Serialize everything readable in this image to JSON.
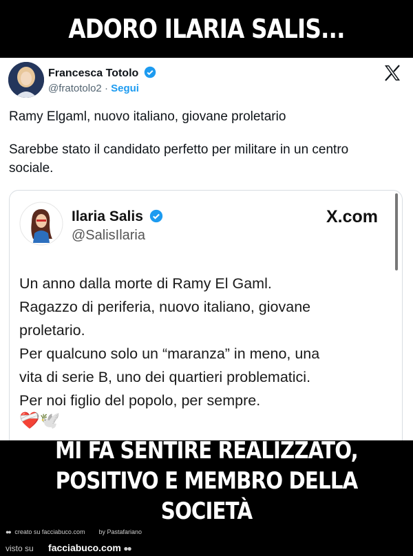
{
  "meme": {
    "top_caption": "ADORO ILARIA SALIS...",
    "bottom_caption_line1": "MI FA SENTIRE REALIZZATO,",
    "bottom_caption_line2": "POSITIVO E MEMBRO DELLA SOCIETÀ"
  },
  "tweet": {
    "author_name": "Francesca Totolo",
    "author_handle": "@fratotolo2",
    "separator": "·",
    "follow_label": "Segui",
    "text_line1": "Ramy Elgaml, nuovo italiano, giovane proletario",
    "text_line2": "Sarebbe stato il candidato perfetto per militare in un centro sociale.",
    "icons": {
      "verified": "verified-badge-icon",
      "platform": "x-logo-icon"
    }
  },
  "quoted": {
    "author_name": "Ilaria Salis",
    "author_handle": "@SalisIlaria",
    "site": "X.com",
    "lines": [
      "Un anno dalla morte di Ramy El Gaml.",
      "Ragazzo di periferia, nuovo italiano, giovane",
      "proletario.",
      "Per qualcuno solo un “maranza” in meno, una",
      "vita di serie B, uno dei quartieri problematici.",
      "Per noi figlio del popolo, per sempre."
    ],
    "emojis": "❤️‍🩹🕊️"
  },
  "footer": {
    "created_label": "creato su facciabuco.com",
    "by_label": "by Pastafariano",
    "seen_label": "visto su",
    "site_label": "facciabuco.com"
  },
  "colors": {
    "accent": "#1d9bf0",
    "badge": "#1d9bf0"
  }
}
